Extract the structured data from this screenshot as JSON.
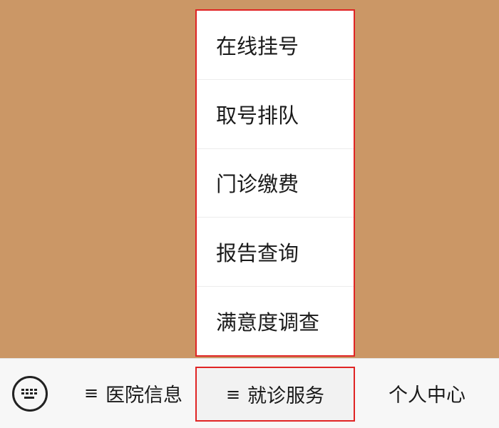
{
  "popup_menu": {
    "items": [
      {
        "label": "在线挂号"
      },
      {
        "label": "取号排队"
      },
      {
        "label": "门诊缴费"
      },
      {
        "label": "报告查询"
      },
      {
        "label": "满意度调查"
      }
    ]
  },
  "bottom_bar": {
    "keyboard_icon": "keyboard-icon",
    "menus": [
      {
        "icon": "≡",
        "label": "医院信息"
      },
      {
        "icon": "≡",
        "label": "就诊服务"
      },
      {
        "label": "个人中心"
      }
    ]
  },
  "colors": {
    "background": "#cb9766",
    "highlight_border": "#e02424"
  }
}
